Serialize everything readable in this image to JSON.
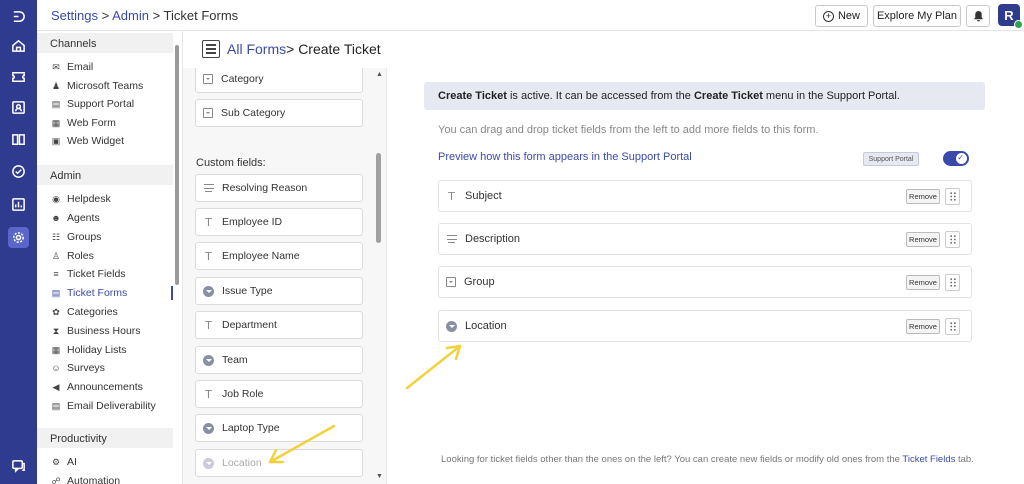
{
  "rail": {
    "icons": [
      "logo-icon",
      "home-icon",
      "tickets-icon",
      "contacts-icon",
      "knowledge-icon",
      "tasks-icon",
      "reports-icon",
      "settings-icon",
      "chat-icon"
    ]
  },
  "topbar": {
    "breadcrumb": {
      "settings": "Settings",
      "sep1": " > ",
      "admin": "Admin",
      "sep2": " > ",
      "current": "Ticket Forms"
    },
    "new_label": "New",
    "explore_label": "Explore My Plan",
    "avatar_initial": "R"
  },
  "sidebar": {
    "channels_title": "Channels",
    "channels": [
      {
        "label": "Email",
        "icon": "mail-icon"
      },
      {
        "label": "Microsoft Teams",
        "icon": "teams-icon"
      },
      {
        "label": "Support Portal",
        "icon": "portal-icon"
      },
      {
        "label": "Web Form",
        "icon": "webform-icon"
      },
      {
        "label": "Web Widget",
        "icon": "widget-icon"
      }
    ],
    "admin_title": "Admin",
    "admin": [
      {
        "label": "Helpdesk",
        "icon": "lifebuoy-icon"
      },
      {
        "label": "Agents",
        "icon": "agent-icon"
      },
      {
        "label": "Groups",
        "icon": "groups-icon"
      },
      {
        "label": "Roles",
        "icon": "roles-icon"
      },
      {
        "label": "Ticket Fields",
        "icon": "ticket-fields-icon"
      },
      {
        "label": "Ticket Forms",
        "icon": "ticket-forms-icon"
      },
      {
        "label": "Categories",
        "icon": "categories-icon"
      },
      {
        "label": "Business Hours",
        "icon": "hourglass-icon"
      },
      {
        "label": "Holiday Lists",
        "icon": "calendar-icon"
      },
      {
        "label": "Surveys",
        "icon": "survey-icon"
      },
      {
        "label": "Announcements",
        "icon": "megaphone-icon"
      },
      {
        "label": "Email Deliverability",
        "icon": "email-deliverability-icon"
      }
    ],
    "productivity_title": "Productivity",
    "productivity": [
      {
        "label": "AI",
        "icon": "ai-gear-icon"
      },
      {
        "label": "Automation",
        "icon": "automation-icon"
      }
    ]
  },
  "title": {
    "link": "All Forms",
    "rest": "> Create Ticket"
  },
  "palette": {
    "top_fields": [
      {
        "label": "Category",
        "type": "dropdown-box"
      },
      {
        "label": "Sub Category",
        "type": "dropdown-box"
      }
    ],
    "custom_label": "Custom fields:",
    "custom_fields": [
      {
        "label": "Resolving Reason",
        "type": "paragraph"
      },
      {
        "label": "Employee ID",
        "type": "text"
      },
      {
        "label": "Employee Name",
        "type": "text"
      },
      {
        "label": "Issue Type",
        "type": "dropdown"
      },
      {
        "label": "Department",
        "type": "text"
      },
      {
        "label": "Team",
        "type": "dropdown"
      },
      {
        "label": "Job Role",
        "type": "text"
      },
      {
        "label": "Laptop Type",
        "type": "dropdown"
      },
      {
        "label": "Location",
        "type": "dropdown"
      }
    ]
  },
  "canvas": {
    "banner": {
      "b1": "Create Ticket",
      "t1": " is active. It can be accessed from the ",
      "b2": "Create Ticket",
      "t2": " menu in the Support Portal."
    },
    "hint": "You can drag and drop ticket fields from the left to add more fields to this form.",
    "preview_link": "Preview how this form appears in the Support Portal",
    "support_portal_badge": "Support Portal",
    "toggle_on": true,
    "form_fields": [
      {
        "label": "Subject",
        "type": "text",
        "remove": "Remove"
      },
      {
        "label": "Description",
        "type": "paragraph",
        "remove": "Remove"
      },
      {
        "label": "Group",
        "type": "dropdown-box",
        "remove": "Remove"
      },
      {
        "label": "Location",
        "type": "dropdown",
        "remove": "Remove"
      }
    ],
    "footer": {
      "text": "Looking for ticket fields other than the ones on the left? You can create new fields or modify old ones from the ",
      "link": "Ticket Fields",
      "tail": " tab."
    }
  },
  "colors": {
    "rail": "#2f3b8f",
    "accent": "#3b4aa8",
    "annotation_arrow": "#f2d13a"
  }
}
